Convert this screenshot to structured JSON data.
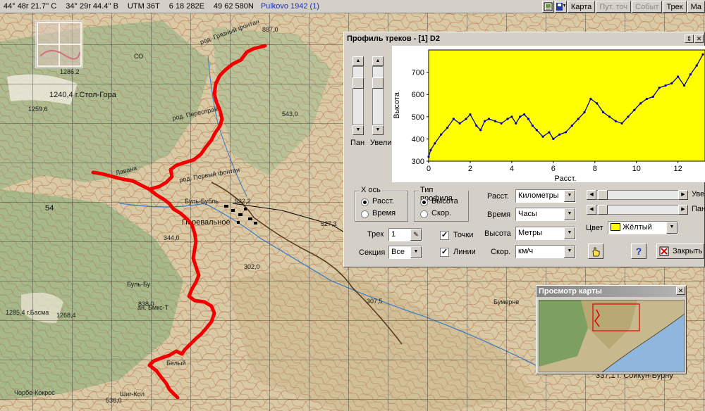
{
  "statusbar": {
    "lat": "44° 48r 21.7'' С",
    "lon": "34° 29r 44.4'' В",
    "utm": "UTM  36T",
    "easting": "6 18 282E",
    "northing": "49 62 580N",
    "datum": "Pulkovo 1942 (1)"
  },
  "toolbar": {
    "map_btn": "Карта",
    "waypoints_btn": "Пут. точ",
    "events_btn": "Событ",
    "track_btn": "Трек",
    "ma_btn": "Ма"
  },
  "map": {
    "labels": [
      "1240,4 г.Стол-Гора",
      "род. Грязный фонтан",
      "род. Пересправ",
      "род. Первый фонтан",
      "Перевальное",
      "Буль-Бубль",
      "Лавана",
      "ан. Бмкс-Т",
      "Буль-Бу",
      "1285,4 г.Басма",
      "1268,4",
      "532,2",
      "307,5",
      "Бумерне",
      "337,1 г. Сойкун-Бурну",
      "Шиг-Кол",
      "Белый",
      "Чорбе-Кокрос",
      "СО",
      "54",
      "1286,2",
      "1259,6",
      "887,0",
      "543,0",
      "527,3",
      "302,0",
      "344,0",
      "838,0",
      "536,0"
    ]
  },
  "profile": {
    "title": "Профиль треков - [1] D2",
    "pan_label": "Пан",
    "zoom_label": "Увели",
    "xaxis_group": "X ось",
    "xaxis_dist": "Расст.",
    "xaxis_time": "Время",
    "ptype_group": "Тип профиля",
    "ptype_alt": "Высота",
    "ptype_speed": "Скор.",
    "track_label": "Трек",
    "track_value": "1",
    "section_label": "Секция",
    "section_value": "Все",
    "points_label": "Точки",
    "lines_label": "Линии",
    "dist_units_label": "Расст.",
    "dist_units_value": "Километры",
    "time_units_label": "Время",
    "time_units_value": "Часы",
    "alt_units_label": "Высота",
    "alt_units_value": "Метры",
    "speed_units_label": "Скор.",
    "speed_units_value": "км/ч",
    "h_zoom_label": "Уве",
    "h_pan_label": "Пан",
    "color_label": "Цвет",
    "color_value": "Жёлтый",
    "help_label": "?",
    "close_label": "Закрыть"
  },
  "chart_data": {
    "type": "line",
    "xlabel": "Расст.",
    "ylabel": "Высота",
    "xlim": [
      0,
      13.3
    ],
    "ylim": [
      300,
      800
    ],
    "xticks": [
      0,
      2,
      4,
      6,
      8,
      10,
      12
    ],
    "yticks": [
      300,
      400,
      500,
      600,
      700
    ],
    "background": "#ffff00",
    "line_color": "#0000a0",
    "grid": false,
    "series": [
      {
        "x": [
          0,
          0.1,
          0.3,
          0.6,
          0.9,
          1.2,
          1.5,
          1.8,
          2.0,
          2.3,
          2.5,
          2.7,
          2.9,
          3.2,
          3.5,
          3.8,
          4.0,
          4.2,
          4.4,
          4.6,
          4.8,
          5.0,
          5.2,
          5.5,
          5.8,
          6.0,
          6.3,
          6.6,
          6.9,
          7.2,
          7.5,
          7.8,
          8.1,
          8.4,
          8.7,
          9.0,
          9.3,
          9.6,
          9.9,
          10.2,
          10.5,
          10.8,
          11.1,
          11.4,
          11.7,
          12.0,
          12.3,
          12.6,
          12.9,
          13.2
        ],
        "y": [
          320,
          350,
          380,
          420,
          450,
          490,
          470,
          490,
          510,
          460,
          440,
          480,
          490,
          480,
          470,
          490,
          500,
          470,
          500,
          510,
          490,
          460,
          440,
          410,
          430,
          400,
          420,
          430,
          460,
          490,
          520,
          580,
          560,
          520,
          500,
          480,
          470,
          500,
          530,
          560,
          580,
          590,
          630,
          640,
          650,
          680,
          640,
          690,
          730,
          780
        ]
      }
    ]
  },
  "overview": {
    "title": "Просмотр карты"
  }
}
